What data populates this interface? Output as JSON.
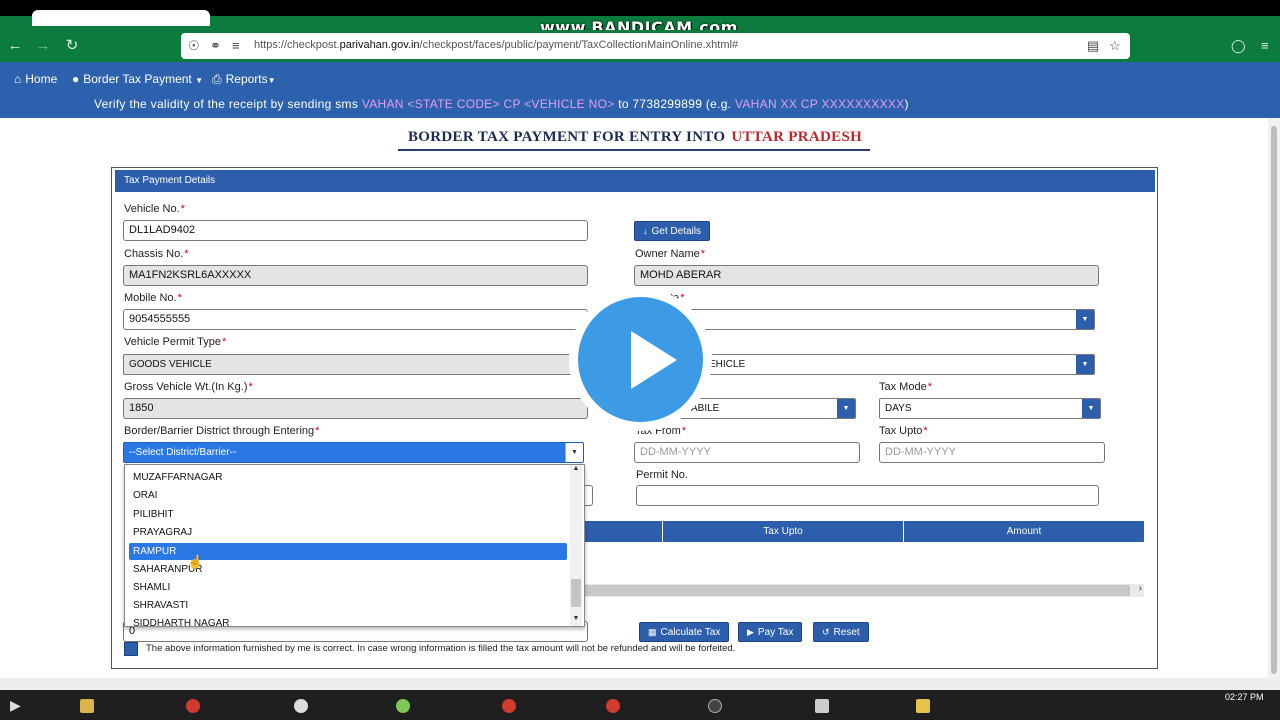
{
  "overlay": {
    "watermark": "www.BANDICAM.com"
  },
  "browser": {
    "url_prefix": "https://checkpost.",
    "url_domain": "parivahan.gov.in",
    "url_path": "/checkpost/faces/public/payment/TaxCollectionMainOnline.xhtml#"
  },
  "nav": {
    "home": "Home",
    "border_tax": "Border Tax Payment",
    "reports": "Reports"
  },
  "verify": {
    "lead": "Verify the validity of the receipt by sending sms",
    "code": "VAHAN <STATE CODE> CP <VEHICLE NO>",
    "to": "to 7738299899 (e.g.",
    "example": "VAHAN XX CP XXXXXXXXXX",
    "close": ")"
  },
  "title": {
    "text": "BORDER TAX PAYMENT FOR ENTRY INTO",
    "state": "UTTAR PRADESH"
  },
  "panel": {
    "header": "Tax Payment Details"
  },
  "form": {
    "vehicle_no_label": "Vehicle No.",
    "vehicle_no": "DL1LAD9402",
    "get_details": "Get Details",
    "chassis_label": "Chassis No.",
    "chassis": "MA1FN2KSRL6AXXXXX",
    "owner_label": "Owner Name",
    "owner": "MOHD ABERAR",
    "mobile_label": "Mobile No.",
    "mobile": "9054555555",
    "state_label_partial": "te",
    "permit_type_label": "Vehicle Permit Type",
    "permit_type": "GOODS VEHICLE",
    "vehicle_class_partial": "EHICLE",
    "gvw_label": "Gross Vehicle Wt.(In Kg.)",
    "gvw": "1850",
    "service_partial": "ABILE",
    "tax_mode_label": "Tax Mode",
    "tax_mode": "DAYS",
    "district_label": "Border/Barrier District through Entering",
    "district": "--Select District/Barrier--",
    "tax_from_label": "Tax From",
    "tax_from_placeholder": "DD-MM-YYYY",
    "tax_upto_label": "Tax Upto",
    "tax_upto_placeholder": "DD-MM-YYYY",
    "permit_no_label": "Permit No.",
    "permit_no": "",
    "amount_value": "0"
  },
  "district_options": [
    "MUZAFFARNAGAR",
    "ORAI",
    "PILIBHIT",
    "PRAYAGRAJ",
    "RAMPUR",
    "SAHARANPUR",
    "SHAMLI",
    "SHRAVASTI",
    "SIDDHARTH NAGAR"
  ],
  "table": {
    "col_tax_upto": "Tax Upto",
    "col_amount": "Amount"
  },
  "buttons": {
    "calculate": "Calculate Tax",
    "pay": "Pay Tax",
    "reset": "Reset"
  },
  "declaration": "The above information furnished by me is correct. In case wrong information is filled the tax amount will not be refunded and will be forfeited.",
  "taskbar": {
    "time": "02:27 PM"
  },
  "colors": {
    "nav_blue": "#2c62ad",
    "browser_green": "#0c7b3e",
    "selected_option": "#2a78e4",
    "state_red": "#c0272d"
  }
}
